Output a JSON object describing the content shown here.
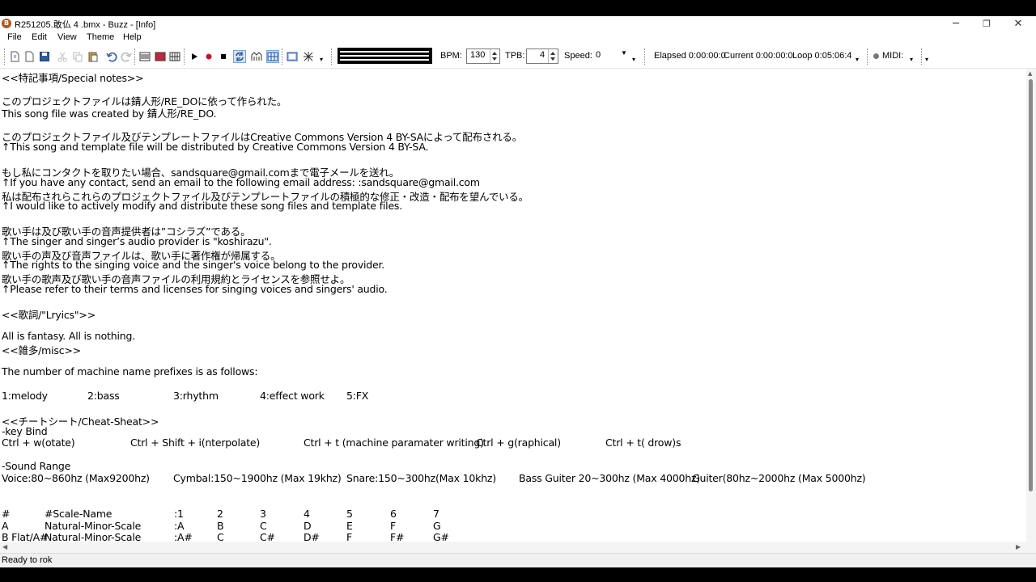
{
  "window": {
    "title": "R251205.敢仏 4 .bmx - Buzz - [Info]",
    "minimize_glyph": "─",
    "restore_glyph": "❐",
    "close_glyph": "✕"
  },
  "menu": {
    "items": [
      "File",
      "Edit",
      "View",
      "Theme",
      "Help"
    ]
  },
  "toolbar": {
    "bpm_label": "BPM:",
    "bpm_value": "130",
    "tpb_label": "TPB:",
    "tpb_value": "4",
    "speed_label": "Speed:",
    "speed_value": "0",
    "elapsed": "Elapsed 0:00:00:0",
    "current": "Current 0:00:00:0",
    "loop": "Loop 0:05:06:4",
    "midi_label": "MIDI:"
  },
  "content": {
    "lines": [
      "<<特記事項/Special notes>>",
      "",
      "このプロジェクトファイルは錆人形/RE_DOに依って作られた。",
      "This song file was created by 錆人形/RE_DO.",
      "",
      "このプロジェクトファイル及びテンプレートファイルはCreative Commons Version 4 BY-SAによって配布される。",
      "↑This song and template file will be distributed by Creative Commons Version 4 BY-SA.",
      "",
      "もし私にコンタクトを取りたい場合、sandsquare@gmail.comまで電子メールを送れ。",
      "↑If you have any contact, send an email to the following email address: :sandsquare@gmail.com",
      "私は配布されらこれらのプロジェクトファイル及びテンプレートファイルの積極的な修正・改造・配布を望んでいる。",
      "↑I would like to actively modify and distribute these song files and template files.",
      "",
      "歌い手は及び歌い手の音声提供者は”コシラズ”である。",
      "↑The singer and singer’s audio provider is \"koshirazu\".",
      "歌い手の声及び音声ファイルは、歌い手に著作権が帰属する。",
      "↑The rights to the singing voice and the singer's voice belong to the provider.",
      "歌い手の歌声及び歌い手の音声ファイルの利用規約とライセンスを参照せよ。",
      "↑Please refer to their terms and licenses for singing voices and singers' audio.",
      "",
      "<<歌詞/\"Lryics\">>",
      "",
      "All is fantasy. All is nothing.",
      "<<雑多/misc>>",
      "",
      "The number of machine name prefixes is as follows:",
      "",
      "",
      "",
      "<<チートシート/Cheat-Sheat>>",
      "-key Bind",
      "",
      "",
      "-Sound Range",
      "",
      "",
      "",
      "",
      "",
      ""
    ],
    "prefix_row": [
      "1:melody",
      "2:bass",
      "3:rhythm",
      "4:effect work",
      "5:FX"
    ],
    "keybind_row": [
      "Ctrl + w(otate)",
      "Ctrl + Shift + i(nterpolate)",
      "Ctrl + t (machine paramater writing)",
      "Ctrl + g(raphical)",
      "Ctrl + t( drow)s"
    ],
    "sound_range_row": [
      "Voice:80~860hz (Max9200hz)",
      "Cymbal:150~1900hz (Max 19khz)",
      "Snare:150~300hz(Max 10khz)",
      "Bass Guiter 20~300hz (Max 4000hz)",
      "Guiter(80hz~2000hz (Max 5000hz)"
    ],
    "scale_table": {
      "header": [
        "#",
        "#Scale-Name",
        ":1",
        "2",
        "3",
        "4",
        "5",
        "6",
        "7"
      ],
      "rows": [
        [
          "A",
          "Natural-Minor-Scale",
          ":A",
          "B",
          "C",
          "D",
          "E",
          "F",
          "G"
        ],
        [
          "B Flat/A#",
          "Natural-Minor-Scale",
          ":A#",
          "C",
          "C#",
          "D#",
          "F",
          "F#",
          "G#"
        ]
      ]
    }
  },
  "status": {
    "text": "Ready to rok"
  }
}
